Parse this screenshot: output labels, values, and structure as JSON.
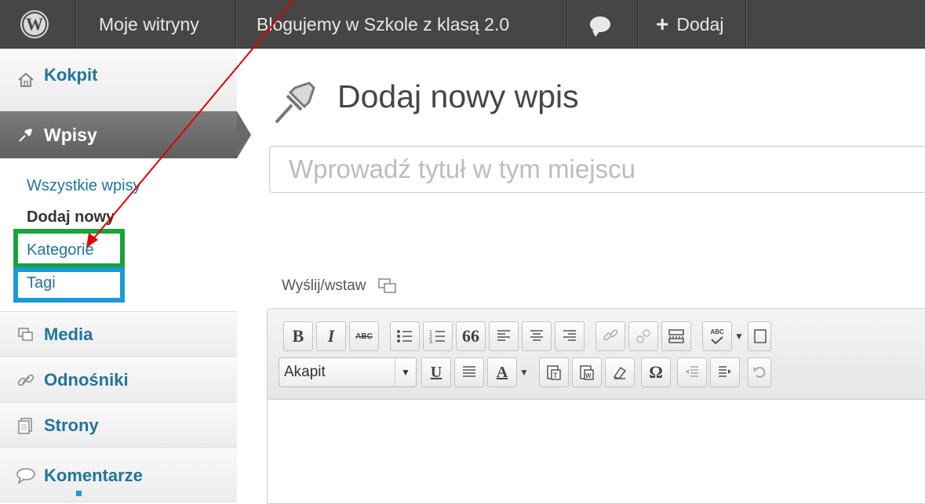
{
  "adminbar": {
    "my_sites": "Moje witryny",
    "site_name": "Blogujemy w Szkole z klasą 2.0",
    "add_new": "Dodaj",
    "add_new_icon": "plus-icon",
    "comments_icon": "comment-bubble-icon"
  },
  "sidebar": {
    "dashboard": "Kokpit",
    "posts": "Wpisy",
    "posts_submenu": {
      "all_posts": "Wszystkie wpisy",
      "add_new": "Dodaj nowy",
      "categories": "Kategorie",
      "tags": "Tagi"
    },
    "media": "Media",
    "links": "Odnośniki",
    "pages": "Strony",
    "comments": "Komentarze"
  },
  "main": {
    "page_title": "Dodaj nowy wpis",
    "title_placeholder": "Wprowadź tytuł w tym miejscu",
    "upload_label": "Wyślij/wstaw"
  },
  "editor": {
    "format_select": "Akapit",
    "bold": "B",
    "italic": "I",
    "strike": "ABC",
    "blockquote": "66",
    "underline": "U",
    "text_color": "A",
    "omega": "Ω",
    "spellcheck": "ABC"
  },
  "annotations": {
    "green_box_color": "#1aa33a",
    "blue_box_color": "#1a9bd6",
    "arrow_color": "#e00000"
  }
}
